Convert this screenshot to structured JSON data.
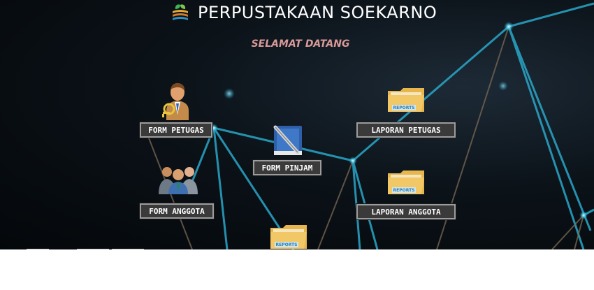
{
  "app": {
    "title": "PERPUSTAKAAN SOEKARNO",
    "welcome": "SELAMAT DATANG",
    "logo_icon": "book-leaf-logo-icon"
  },
  "menu": {
    "form_petugas": "FORM PETUGAS",
    "form_anggota": "FORM ANGGOTA",
    "form_pinjam": "FORM PINJAM",
    "laporan_petugas": "LAPORAN PETUGAS",
    "laporan_anggota": "LAPORAN ANGGOTA"
  },
  "icons": {
    "petugas": "officer-key-icon",
    "anggota": "members-group-icon",
    "pinjam": "notebook-pen-icon",
    "report": "reports-folder-icon",
    "report_label": "REPORTS"
  },
  "colors": {
    "title": "#ffffff",
    "welcome": "#d99a98",
    "button_bg": "#3a3a3a",
    "button_border": "#9c9c9c",
    "network_line": "#2aa7c9"
  }
}
